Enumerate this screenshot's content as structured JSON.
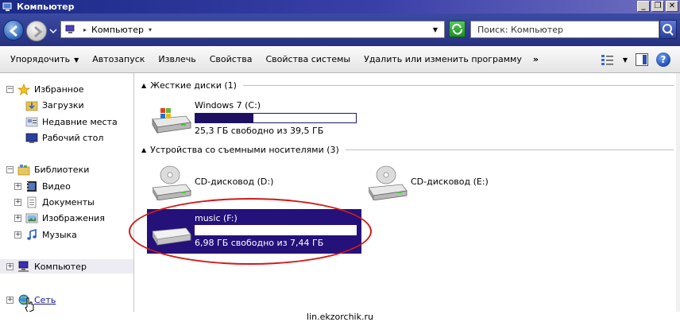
{
  "window": {
    "title": "Компьютер",
    "buttons": {
      "minimize": "_",
      "restore": "❐",
      "close": "✕"
    }
  },
  "address": {
    "path": "Компьютер",
    "search_placeholder": "Поиск: Компьютер"
  },
  "toolbar": {
    "items": [
      "Упорядочить",
      "Автозапуск",
      "Извлечь",
      "Свойства",
      "Свойства системы",
      "Удалить или изменить программу"
    ],
    "more": "»"
  },
  "sidebar": {
    "favorites": "Избранное",
    "downloads": "Загрузки",
    "recent": "Недавние места",
    "desktop": "Рабочий стол",
    "libraries": "Библиотеки",
    "video": "Видео",
    "documents": "Документы",
    "images": "Изображения",
    "music": "Музыка",
    "computer": "Компьютер",
    "network": "Сеть"
  },
  "groups": {
    "hard_drives": "Жесткие диски (1)",
    "removable": "Устройства со съемными носителями (3)"
  },
  "drives": {
    "c": {
      "name": "Windows 7 (C:)",
      "info": "25,3 ГБ свободно из 39,5 ГБ",
      "used_fraction": 0.36
    },
    "d": {
      "name": "CD-дисковод (D:)"
    },
    "e": {
      "name": "CD-дисковод (E:)"
    },
    "f": {
      "name": "music (F:)",
      "info": "6,98 ГБ свободно из 7,44 ГБ",
      "used_fraction": 0.06
    }
  },
  "watermark": "lin.ekzorchik.ru",
  "colors": {
    "selection": "#24117a",
    "highlight_ring": "#d01a1a",
    "titlebar": "#1b2b88"
  }
}
